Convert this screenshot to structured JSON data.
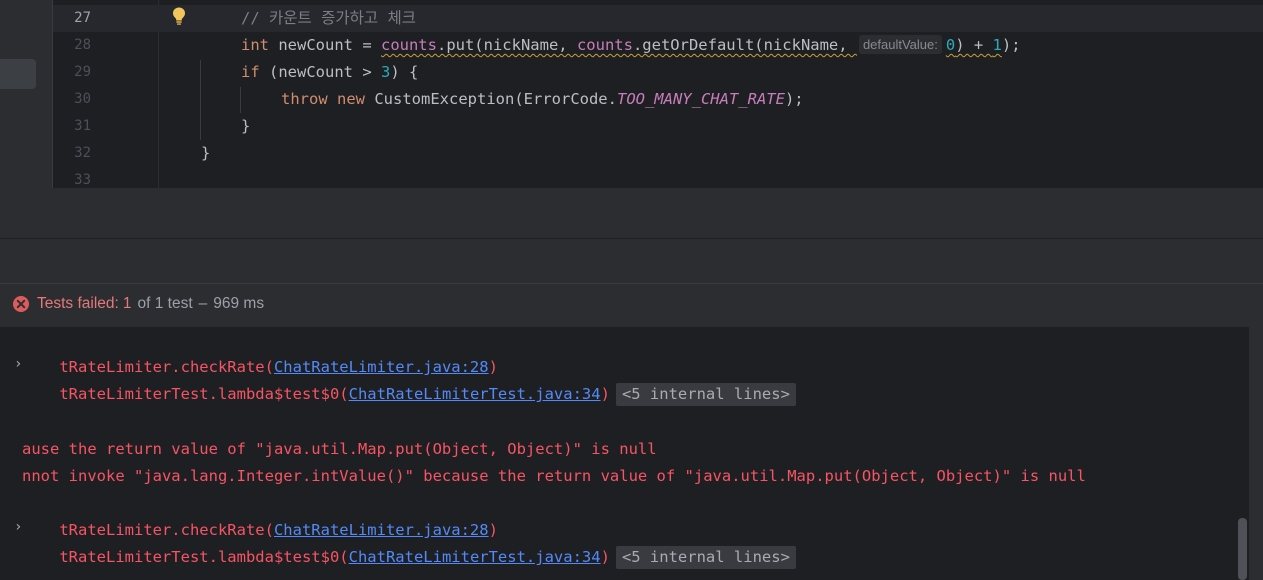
{
  "editor": {
    "lines": [
      {
        "num": "27",
        "comment": "// 카운트 증가하고 체크"
      },
      {
        "num": "28",
        "kw_int": "int",
        "t1": " newCount = ",
        "field1": "counts",
        "t2": ".put(nickName, ",
        "field2": "counts",
        "t3": ".getOrDefault(nickName, ",
        "hint": "defaultValue:",
        "num0": "0",
        "t4": ") + ",
        "num1": "1",
        "t5": ");"
      },
      {
        "num": "29",
        "kw_if": "if",
        "t1": " (newCount > ",
        "num3": "3",
        "t2": ") {"
      },
      {
        "num": "30",
        "kw_throw": "throw",
        "sp": " ",
        "kw_new": "new",
        "t1": " CustomException(ErrorCode.",
        "const": "TOO_MANY_CHAT_RATE",
        "t2": ");"
      },
      {
        "num": "31",
        "t": "}"
      },
      {
        "num": "32",
        "t": "}"
      },
      {
        "num": "33",
        "t": ""
      }
    ]
  },
  "test_status": {
    "failed_label": "Tests failed:",
    "failed_count": "1",
    "of_text": "of 1 test",
    "separator": "–",
    "duration": "969 ms"
  },
  "console": {
    "lines": [
      {
        "pre": "tRateLimiter.checkRate(",
        "link": "ChatRateLimiter.java:28",
        "post": ")"
      },
      {
        "pre": "tRateLimiterTest.lambda$test$0(",
        "link": "ChatRateLimiterTest.java:34",
        "post": ")",
        "fold": "<5 internal lines>",
        "arrow": "›"
      },
      {
        "text": "ause the return value of \"java.util.Map.put(Object, Object)\" is null"
      },
      {
        "text": "nnot invoke \"java.lang.Integer.intValue()\" because the return value of \"java.util.Map.put(Object, Object)\" is null"
      },
      {
        "pre": "tRateLimiter.checkRate(",
        "link": "ChatRateLimiter.java:28",
        "post": ")"
      },
      {
        "pre": "tRateLimiterTest.lambda$test$0(",
        "link": "ChatRateLimiterTest.java:34",
        "post": ")",
        "fold": "<5 internal lines>",
        "arrow": "›"
      }
    ]
  },
  "colors": {
    "background": "#1e1f22",
    "panel": "#2b2d30",
    "error_text": "#f75464",
    "link": "#548af7",
    "keyword": "#cf8e6d",
    "field": "#c77dbb",
    "number": "#2aacb8",
    "comment": "#7a7e85"
  },
  "icons": {
    "bulb": "lightbulb-icon",
    "failed": "test-failed-icon",
    "expand": "chevron-right-icon"
  }
}
